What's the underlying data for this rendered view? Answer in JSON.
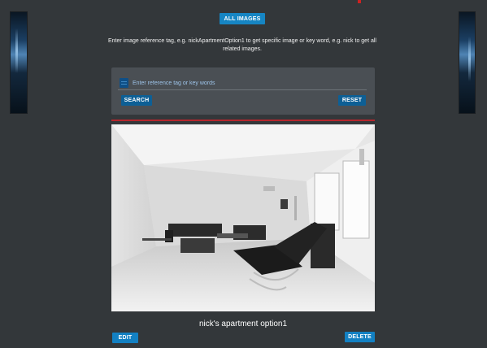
{
  "header": {
    "all_images_label": "ALL IMAGES"
  },
  "instructions": {
    "line1": "Enter image reference tag, e.g. nickApartmentOption1 to get specific image or key word, e.g. nick to get all",
    "line2": "related images."
  },
  "search": {
    "placeholder": "Enter reference tag or key words",
    "value": "",
    "search_label": "SEARCH",
    "reset_label": "RESET"
  },
  "result": {
    "caption": "nick's apartment option1",
    "edit_label": "EDIT",
    "delete_label": "DELETE"
  },
  "icons": {
    "search_field_icon": "list-icon"
  },
  "colors": {
    "background": "#33373a",
    "button": "#1279b6",
    "panel": "#4a4f54",
    "divider": "#b4262c"
  }
}
